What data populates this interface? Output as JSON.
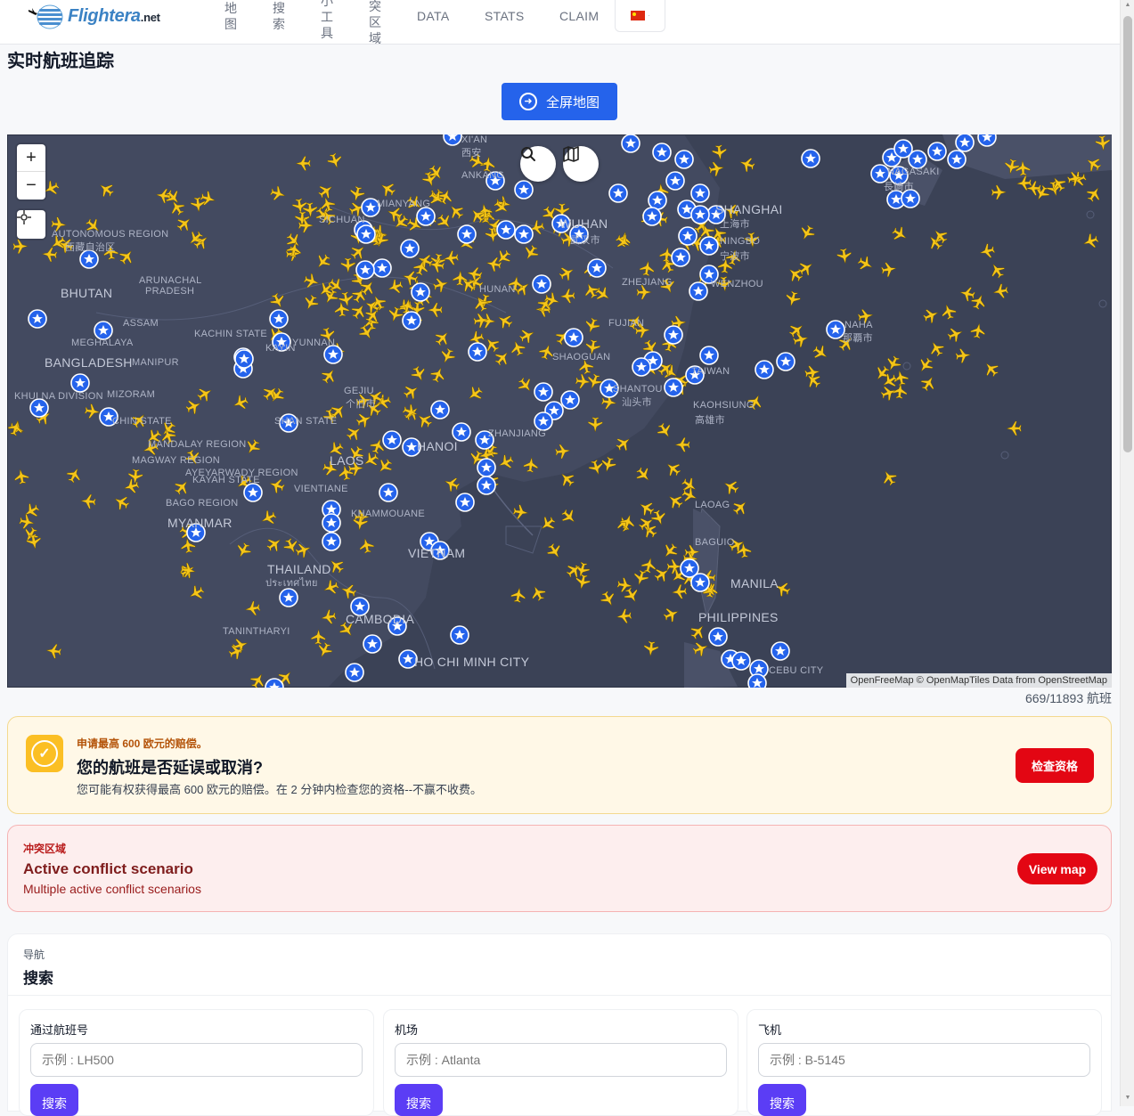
{
  "brand": {
    "name": "Flightera",
    "suffix": ".net"
  },
  "nav": {
    "items_cjk": [
      {
        "label": "地\n图"
      },
      {
        "label": "搜\n索"
      },
      {
        "label": "小\n工\n具"
      },
      {
        "label": "突\n区\n域"
      }
    ],
    "items_latin": [
      {
        "label": "DATA"
      },
      {
        "label": "STATS"
      },
      {
        "label": "CLAIM"
      }
    ],
    "language": {
      "flag": "cn-flag",
      "caret": "·"
    }
  },
  "page": {
    "title": "实时航班追踪",
    "fullscreen_label": "全屏地图"
  },
  "map": {
    "zoom_in": "+",
    "zoom_out": "−",
    "attribution": "OpenFreeMap © OpenMapTiles Data from OpenStreetMap",
    "flight_count": "669/11893 航班",
    "colors": {
      "background": "#3b4256",
      "aircraft": "#f5c518",
      "airport": "#2563eb"
    },
    "labels": [
      {
        "text": "XI'AN"
      },
      {
        "text": "西安"
      },
      {
        "text": "ANKANG"
      },
      {
        "text": "SHANGHAI"
      },
      {
        "text": "上海市"
      },
      {
        "text": "NINGBO"
      },
      {
        "text": "宁波市"
      },
      {
        "text": "WUHAN"
      },
      {
        "text": "武汉市"
      },
      {
        "text": "MIANYANG"
      },
      {
        "text": "AUTONOMOUS REGION"
      },
      {
        "text": "西藏自治区"
      },
      {
        "text": "BHUTAN"
      },
      {
        "text": "ARUNACHAL"
      },
      {
        "text": "PRADESH"
      },
      {
        "text": "ASSAM"
      },
      {
        "text": "MEGHALAYA"
      },
      {
        "text": "KACHIN STATE"
      },
      {
        "text": "BANGLADESH"
      },
      {
        "text": "MANIPUR"
      },
      {
        "text": "MIZORAM"
      },
      {
        "text": "KHULNA DIVISION"
      },
      {
        "text": "CHIN STATE"
      },
      {
        "text": "MANDALAY REGION"
      },
      {
        "text": "MAGWAY REGION"
      },
      {
        "text": "AYEYARWADY REGION"
      },
      {
        "text": "KAYAH STATE"
      },
      {
        "text": "BAGO REGION"
      },
      {
        "text": "MYANMAR"
      },
      {
        "text": "SHAN STATE"
      },
      {
        "text": "GEJIU"
      },
      {
        "text": "个旧市"
      },
      {
        "text": "LAOS"
      },
      {
        "text": "VIENTIANE"
      },
      {
        "text": "KHAMMOUANE"
      },
      {
        "text": "THAILAND"
      },
      {
        "text": "ประเทศไทย"
      },
      {
        "text": "TANINTHARYI"
      },
      {
        "text": "CAMBODIA"
      },
      {
        "text": "HO CHI MINH CITY"
      },
      {
        "text": "VIETNAM"
      },
      {
        "text": "HANOI"
      },
      {
        "text": "ZHANJIANG"
      },
      {
        "text": "SHAOGUAN"
      },
      {
        "text": "SHANTOU"
      },
      {
        "text": "汕头市"
      },
      {
        "text": "TAIWAN"
      },
      {
        "text": "KAOHSIUNG"
      },
      {
        "text": "高雄市"
      },
      {
        "text": "WENZHOU"
      },
      {
        "text": "NAHA"
      },
      {
        "text": "那覇市"
      },
      {
        "text": "NAGASAKI"
      },
      {
        "text": "長崎市"
      },
      {
        "text": "LAOAG"
      },
      {
        "text": "BAGUIO"
      },
      {
        "text": "MANILA"
      },
      {
        "text": "PHILIPPINES"
      },
      {
        "text": "CEBU CITY"
      },
      {
        "text": "HUNAN"
      },
      {
        "text": "FUJIAN"
      },
      {
        "text": "ZHEJIANG"
      },
      {
        "text": "SICHUAN"
      },
      {
        "text": "YUNNAN"
      },
      {
        "text": "KAYIN"
      }
    ]
  },
  "claim": {
    "eyebrow": "申请最高 600 欧元的赔偿。",
    "title": "您的航班是否延误或取消?",
    "description": "您可能有权获得最高 600 欧元的赔偿。在 2 分钟内检查您的资格--不赢不收费。",
    "button": "检查资格"
  },
  "conflict": {
    "eyebrow": "冲突区域",
    "title": "Active conflict scenario",
    "description": "Multiple active conflict scenarios",
    "button": "View map"
  },
  "navigation": {
    "eyebrow": "导航",
    "title": "搜索",
    "boxes": [
      {
        "label": "通过航班号",
        "placeholder": "示例 : LH500",
        "button": "搜索"
      },
      {
        "label": "机场",
        "placeholder": "示例 : Atlanta",
        "button": "搜索"
      },
      {
        "label": "飞机",
        "placeholder": "示例 : B-5145",
        "button": "搜索"
      }
    ]
  }
}
